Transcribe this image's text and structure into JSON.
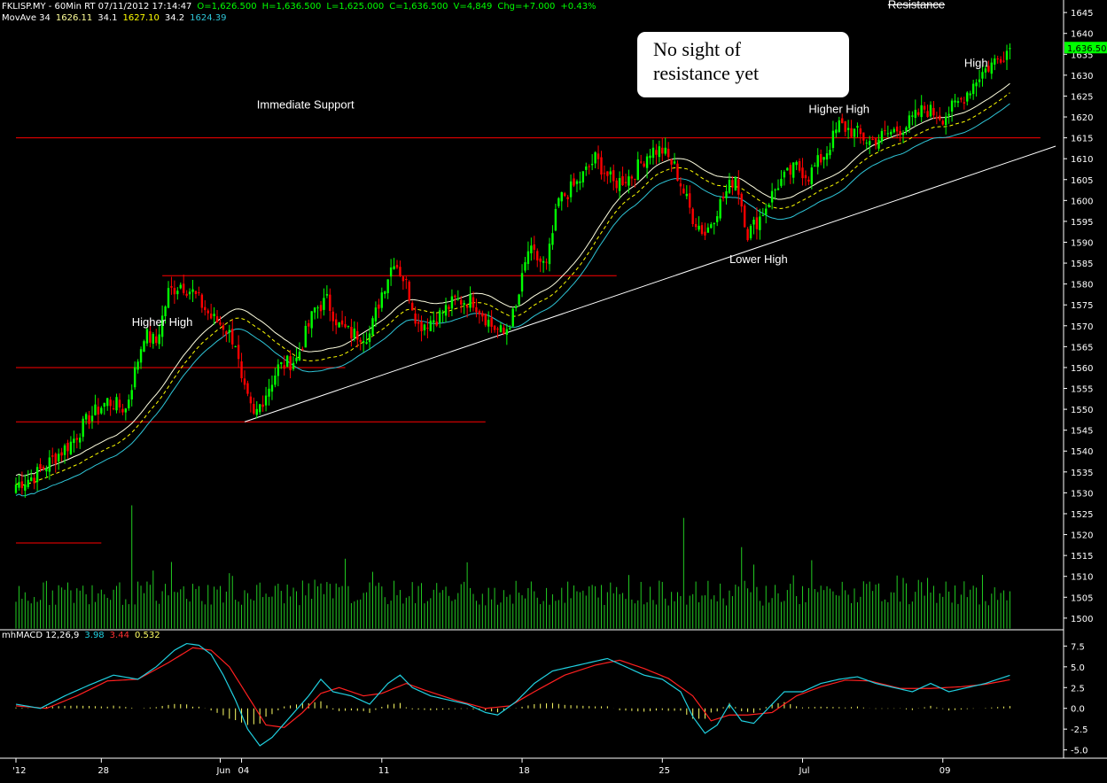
{
  "colors": {
    "background": "#000000",
    "up_candle": "#00ff00",
    "down_candle": "#ff0000",
    "ma_upper": "#ffffe0",
    "ma_mid": "#ffff00",
    "ma_lower": "#2ec4d6",
    "support_line": "#ff0000",
    "trendline": "#ffffff",
    "volume": "#22cc22",
    "macd": "#20d0e0",
    "signal": "#ff2020",
    "histogram": "#ffff66",
    "price_tag": "#00ff00"
  },
  "header": {
    "line1": [
      {
        "text": "FKLISP.MY - 60Min RT  07/11/2012 17:14:47",
        "color": "#ffffff"
      },
      {
        "text": "O=1,626.500",
        "color": "#00ff00"
      },
      {
        "text": "H=1,636.500",
        "color": "#00ff00"
      },
      {
        "text": "L=1,625.000",
        "color": "#00ff00"
      },
      {
        "text": "C=1,636.500",
        "color": "#00ff00"
      },
      {
        "text": "V=4,849",
        "color": "#00ff00"
      },
      {
        "text": "Chg=+7.000",
        "color": "#00ff00"
      },
      {
        "text": "+0.43%",
        "color": "#00ff00"
      }
    ],
    "line2": [
      {
        "text": "MovAve 34",
        "color": "#ffffff"
      },
      {
        "text": "1626.11",
        "color": "#ffff99"
      },
      {
        "text": "34.1",
        "color": "#ffffff"
      },
      {
        "text": "1627.10",
        "color": "#ffff00"
      },
      {
        "text": "34.2",
        "color": "#ffffff"
      },
      {
        "text": "1624.39",
        "color": "#2ec4d6"
      }
    ],
    "macd_line": [
      {
        "text": "mhMACD 12,26,9",
        "color": "#ffffff"
      },
      {
        "text": "3.98",
        "color": "#20d0e0"
      },
      {
        "text": "3.44",
        "color": "#ff3030"
      },
      {
        "text": "0.532",
        "color": "#ffff66"
      }
    ]
  },
  "note": {
    "line1": "No sight of",
    "line2": "resistance yet"
  },
  "chart_data": {
    "type": "candlestick",
    "price_axis": {
      "min": 1497,
      "max": 1648,
      "ticks": [
        "1645",
        "1640",
        "1635",
        "1630",
        "1625",
        "1620",
        "1615",
        "1610",
        "1605",
        "1600",
        "1595",
        "1590",
        "1585",
        "1580",
        "1575",
        "1570",
        "1565",
        "1560",
        "1555",
        "1550",
        "1545",
        "1540",
        "1535",
        "1530",
        "1525",
        "1520",
        "1515",
        "1510",
        "1505",
        "1500"
      ]
    },
    "macd_axis": {
      "min": -6,
      "max": 8.5,
      "ticks": [
        {
          "value": 7.5,
          "label": "7.5"
        },
        {
          "value": 5,
          "label": "5.0"
        },
        {
          "value": 2.5,
          "label": "2.5"
        },
        {
          "value": 0,
          "label": "0.0"
        },
        {
          "value": -2.5,
          "label": "-2.5"
        },
        {
          "value": -5,
          "label": "-5.0"
        }
      ]
    },
    "x_axis_labels": [
      {
        "bar": 0,
        "label": "'12"
      },
      {
        "bar": 28,
        "label": "28"
      },
      {
        "bar": 67,
        "label": "Jun"
      },
      {
        "bar": 74,
        "label": "04"
      },
      {
        "bar": 120,
        "label": "11"
      },
      {
        "bar": 166,
        "label": "18"
      },
      {
        "bar": 212,
        "label": "25"
      },
      {
        "bar": 258,
        "label": "Jul"
      },
      {
        "bar": 304,
        "label": "09"
      }
    ],
    "total_bars": 330,
    "close_path": [
      [
        0,
        1532
      ],
      [
        6,
        1534
      ],
      [
        12,
        1538
      ],
      [
        18,
        1542
      ],
      [
        24,
        1548
      ],
      [
        30,
        1552
      ],
      [
        36,
        1550
      ],
      [
        42,
        1568
      ],
      [
        46,
        1566
      ],
      [
        50,
        1578
      ],
      [
        54,
        1580
      ],
      [
        58,
        1578
      ],
      [
        64,
        1572
      ],
      [
        68,
        1570
      ],
      [
        72,
        1566
      ],
      [
        74,
        1556
      ],
      [
        78,
        1548
      ],
      [
        82,
        1554
      ],
      [
        86,
        1560
      ],
      [
        92,
        1562
      ],
      [
        98,
        1574
      ],
      [
        102,
        1576
      ],
      [
        106,
        1570
      ],
      [
        110,
        1568
      ],
      [
        116,
        1568
      ],
      [
        120,
        1578
      ],
      [
        124,
        1586
      ],
      [
        128,
        1580
      ],
      [
        132,
        1570
      ],
      [
        138,
        1572
      ],
      [
        144,
        1576
      ],
      [
        150,
        1576
      ],
      [
        156,
        1570
      ],
      [
        160,
        1568
      ],
      [
        164,
        1574
      ],
      [
        168,
        1588
      ],
      [
        174,
        1584
      ],
      [
        178,
        1600
      ],
      [
        184,
        1604
      ],
      [
        190,
        1610
      ],
      [
        196,
        1604
      ],
      [
        202,
        1606
      ],
      [
        208,
        1612
      ],
      [
        212,
        1612
      ],
      [
        216,
        1608
      ],
      [
        222,
        1596
      ],
      [
        226,
        1592
      ],
      [
        230,
        1598
      ],
      [
        236,
        1606
      ],
      [
        240,
        1592
      ],
      [
        244,
        1596
      ],
      [
        250,
        1604
      ],
      [
        256,
        1608
      ],
      [
        260,
        1606
      ],
      [
        266,
        1612
      ],
      [
        270,
        1618
      ],
      [
        276,
        1616
      ],
      [
        280,
        1614
      ],
      [
        286,
        1616
      ],
      [
        292,
        1618
      ],
      [
        298,
        1622
      ],
      [
        304,
        1620
      ],
      [
        310,
        1624
      ],
      [
        316,
        1630
      ],
      [
        322,
        1634
      ],
      [
        326,
        1636.5
      ]
    ],
    "last_price": {
      "value": 1636.5,
      "label": "1,636.50"
    },
    "support_lines": [
      {
        "price": 1615,
        "from_bar": 0,
        "to_bar": 336
      },
      {
        "price": 1582,
        "from_bar": 48,
        "to_bar": 197
      },
      {
        "price": 1560,
        "from_bar": 0,
        "to_bar": 108
      },
      {
        "price": 1547,
        "from_bar": 0,
        "to_bar": 154
      },
      {
        "price": 1518,
        "from_bar": 0,
        "to_bar": 28
      }
    ],
    "trendline": {
      "from": [
        75,
        1547
      ],
      "to": [
        341,
        1613
      ]
    },
    "annotations": [
      {
        "text": "Immediate Support",
        "bar": 79,
        "price": 1622
      },
      {
        "text": "Higher High",
        "bar": 38,
        "price": 1570
      },
      {
        "text": "Higher High",
        "bar": 260,
        "price": 1621
      },
      {
        "text": "Lower High",
        "bar": 234,
        "price": 1585
      },
      {
        "text": "High",
        "bar": 311,
        "price": 1632
      },
      {
        "text": "Resistance",
        "bar": 286,
        "price": 1646,
        "strikethrough": true
      }
    ],
    "volume_max": 1527,
    "macd_path": [
      [
        0,
        0.5
      ],
      [
        8,
        0.0
      ],
      [
        16,
        1.5
      ],
      [
        24,
        2.8
      ],
      [
        32,
        4.0
      ],
      [
        40,
        3.5
      ],
      [
        46,
        5.0
      ],
      [
        52,
        7.0
      ],
      [
        56,
        7.8
      ],
      [
        60,
        7.6
      ],
      [
        64,
        6.5
      ],
      [
        68,
        4.0
      ],
      [
        72,
        1.0
      ],
      [
        76,
        -2.5
      ],
      [
        80,
        -4.5
      ],
      [
        84,
        -3.5
      ],
      [
        90,
        -1.0
      ],
      [
        96,
        1.5
      ],
      [
        100,
        3.5
      ],
      [
        104,
        2.0
      ],
      [
        110,
        1.5
      ],
      [
        116,
        0.5
      ],
      [
        122,
        3.0
      ],
      [
        126,
        4.0
      ],
      [
        130,
        2.5
      ],
      [
        136,
        1.5
      ],
      [
        142,
        1.0
      ],
      [
        148,
        0.5
      ],
      [
        154,
        -0.5
      ],
      [
        158,
        -0.8
      ],
      [
        164,
        0.8
      ],
      [
        170,
        3.0
      ],
      [
        176,
        4.5
      ],
      [
        182,
        5.0
      ],
      [
        188,
        5.5
      ],
      [
        194,
        6.0
      ],
      [
        200,
        5.0
      ],
      [
        206,
        4.0
      ],
      [
        212,
        3.5
      ],
      [
        218,
        2.0
      ],
      [
        222,
        -1.0
      ],
      [
        226,
        -3.0
      ],
      [
        230,
        -2.0
      ],
      [
        234,
        0.5
      ],
      [
        238,
        -1.5
      ],
      [
        242,
        -1.8
      ],
      [
        248,
        0.5
      ],
      [
        252,
        2.0
      ],
      [
        258,
        2.0
      ],
      [
        264,
        3.0
      ],
      [
        270,
        3.5
      ],
      [
        276,
        3.8
      ],
      [
        282,
        3.0
      ],
      [
        288,
        2.5
      ],
      [
        294,
        2.0
      ],
      [
        300,
        3.0
      ],
      [
        306,
        2.0
      ],
      [
        312,
        2.5
      ],
      [
        318,
        3.0
      ],
      [
        322,
        3.5
      ],
      [
        326,
        3.98
      ]
    ],
    "signal_path": [
      [
        0,
        0.3
      ],
      [
        10,
        0.0
      ],
      [
        20,
        1.5
      ],
      [
        30,
        3.3
      ],
      [
        40,
        3.5
      ],
      [
        50,
        5.5
      ],
      [
        58,
        7.3
      ],
      [
        64,
        7.0
      ],
      [
        70,
        5.0
      ],
      [
        76,
        1.5
      ],
      [
        82,
        -2.0
      ],
      [
        88,
        -2.3
      ],
      [
        94,
        -0.5
      ],
      [
        100,
        1.8
      ],
      [
        106,
        2.5
      ],
      [
        114,
        1.5
      ],
      [
        120,
        1.8
      ],
      [
        128,
        3.0
      ],
      [
        134,
        2.2
      ],
      [
        144,
        1.0
      ],
      [
        154,
        0.0
      ],
      [
        162,
        0.3
      ],
      [
        170,
        2.0
      ],
      [
        180,
        4.0
      ],
      [
        190,
        5.2
      ],
      [
        198,
        5.8
      ],
      [
        206,
        4.8
      ],
      [
        214,
        3.6
      ],
      [
        222,
        1.5
      ],
      [
        228,
        -1.5
      ],
      [
        234,
        -0.8
      ],
      [
        240,
        -0.8
      ],
      [
        248,
        -0.5
      ],
      [
        256,
        1.5
      ],
      [
        264,
        2.6
      ],
      [
        272,
        3.4
      ],
      [
        280,
        3.3
      ],
      [
        290,
        2.4
      ],
      [
        300,
        2.4
      ],
      [
        310,
        2.6
      ],
      [
        318,
        2.9
      ],
      [
        326,
        3.44
      ]
    ]
  }
}
